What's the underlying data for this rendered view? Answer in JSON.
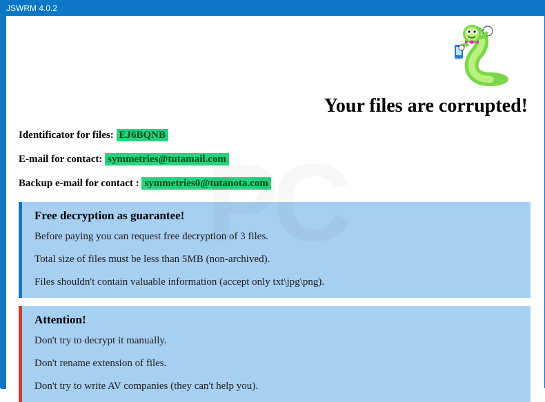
{
  "window": {
    "title": "JSWRM 4.0.2"
  },
  "headline": "Your files are corrupted!",
  "info": {
    "id_label": "Identificator for files: ",
    "id_value": "EJ6BQNB",
    "email_label": "E-mail for contact: ",
    "email_value": "symmetries@tutamail.com",
    "backup_label": "Backup e-mail for contact : ",
    "backup_value": "symmetries0@tutanota.com"
  },
  "box_guarantee": {
    "title": "Free decryption as guarantee!",
    "lines": [
      "Before paying you can request free decryption of 3 files.",
      "Total size of files must be less than 5MB (non-archived).",
      "Files shouldn't contain valuable information (accept only txt\\jpg\\png)."
    ]
  },
  "box_attention": {
    "title": "Attention!",
    "lines": [
      "Don't try to decrypt it manually.",
      "Don't rename extension of files.",
      "Don't try to write AV companies (they can't help you)."
    ]
  },
  "icons": {
    "worm": "worm-mascot-icon"
  },
  "colors": {
    "accent": "#0b77c5",
    "highlight": "#29d17c",
    "box_bg": "#a7cff2",
    "warn_border": "#d43b2f"
  }
}
